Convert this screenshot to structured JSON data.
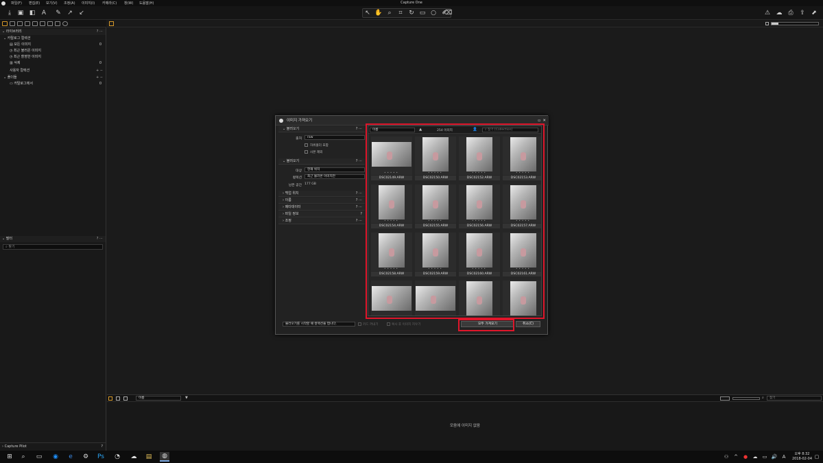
{
  "window": {
    "title": "Capture One"
  },
  "menu": [
    "파일(F)",
    "편집(E)",
    "보기(V)",
    "조정(A)",
    "이미지(I)",
    "카메라(C)",
    "창(W)",
    "도움말(H)"
  ],
  "library": {
    "section": "라이브러리",
    "catalog_collections": "카탈로그 컬렉션",
    "items": [
      {
        "label": "모든 이미지",
        "count": "0"
      },
      {
        "label": "최근 불러온 이미지",
        "count": ""
      },
      {
        "label": "최근 촬영한 이미지",
        "count": ""
      },
      {
        "label": "삭제",
        "count": "0"
      }
    ],
    "user_collections": "사용자 컬렉션",
    "folders": "폴더들",
    "folder_item": {
      "label": "카탈로그에서",
      "count": "0"
    }
  },
  "filters": {
    "section": "필터",
    "search_placeholder": "찾기"
  },
  "capture_pilot": "Capture Pilot",
  "browser": {
    "sort": "이름",
    "search": "찾기",
    "empty": "모음에 이미지 없음"
  },
  "dialog": {
    "title": "이미지 가져오기",
    "import_from": "불러오기",
    "from_label": "출처",
    "from_value": "raw",
    "include_sub": "하위폴더 포함",
    "exclude_dup": "사본 제외",
    "import_to": "불러오기",
    "dest_label": "대상",
    "dest_value": "현재 위치",
    "collection_label": "컬렉션",
    "collection_value": "최근 불러온 이미지만",
    "space_label": "남은 공간",
    "space_value": "177 GB",
    "sections": [
      "백업 위치",
      "이름",
      "메타데이터",
      "파일 정보",
      "조정"
    ],
    "sort_value": "이름",
    "image_count": "254 이미지",
    "grid_search": "찾기 [Collection]",
    "open_option": "불러오기를 시작할 때 컬렉션을 엽니다.",
    "eject": "카드 꺼내기",
    "delete_after": "복사 후 이미지 지우기",
    "import_all": "모두 가져오기",
    "cancel": "취소(C)",
    "thumbs": [
      {
        "name": "DSC02149.ARW"
      },
      {
        "name": "DSC02150.ARW"
      },
      {
        "name": "DSC02152.ARW"
      },
      {
        "name": "DSC02153.ARW"
      },
      {
        "name": "DSC02154.ARW"
      },
      {
        "name": "DSC02155.ARW"
      },
      {
        "name": "DSC02156.ARW"
      },
      {
        "name": "DSC02157.ARW"
      },
      {
        "name": "DSC02158.ARW"
      },
      {
        "name": "DSC02159.ARW"
      },
      {
        "name": "DSC02160.ARW"
      },
      {
        "name": "DSC02161.ARW"
      },
      {
        "name": ""
      },
      {
        "name": ""
      },
      {
        "name": ""
      },
      {
        "name": ""
      }
    ]
  },
  "taskbar": {
    "time": "오후 8:32",
    "date": "2018-02-04",
    "lang": "A"
  },
  "colors": {
    "accent": "#d89a2a",
    "highlight": "#e0162b"
  }
}
